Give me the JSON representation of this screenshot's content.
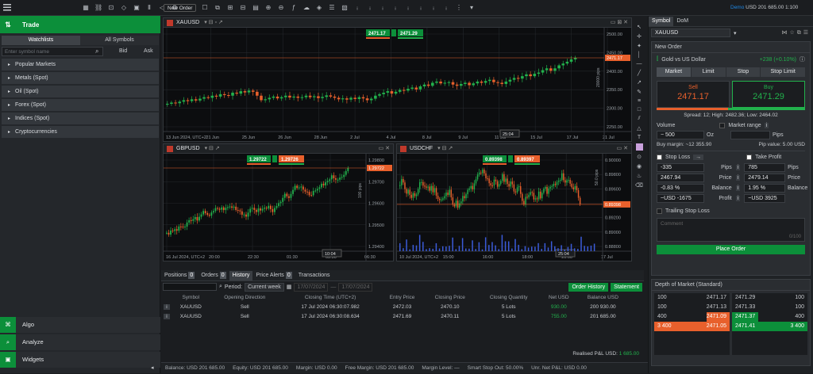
{
  "topbar": {
    "new_order": "New Order",
    "account": "Demo",
    "balance": "USD 201 685.00",
    "leverage": "1:100"
  },
  "left": {
    "trade": "Trade",
    "tabs": [
      "Watchlists",
      "All Symbols"
    ],
    "search_placeholder": "Enter symbol name",
    "bid": "Bid",
    "ask": "Ask",
    "categories": [
      "Popular Markets",
      "Metals (Spot)",
      "Oil (Spot)",
      "Forex (Spot)",
      "Indices (Spot)",
      "Cryptocurrencies"
    ],
    "nav": [
      "Algo",
      "Analyze",
      "Widgets"
    ]
  },
  "charts": {
    "main": {
      "symbol": "XAUUSD",
      "sell_tag": "2471.17",
      "buy_tag": "2471.29",
      "price_label": "2471.17",
      "y_ticks": [
        "2500.00",
        "2450.00",
        "2400.00",
        "2350.00",
        "2300.00",
        "2250.00"
      ],
      "pips_label": "20000 pips",
      "x_ticks": [
        "13 Jun 2024, UTC+2",
        "21 Jun",
        "25 Jun",
        "26 Jun",
        "28 Jun",
        "2 Jul",
        "4 Jul",
        "8 Jul",
        "9 Jul",
        "11 Jul",
        "15 Jul",
        "17 Jul",
        "21 Jul"
      ],
      "countdown": "25:04",
      "candles": [
        2318,
        2322,
        2320,
        2325,
        2330,
        2327,
        2333,
        2329,
        2335,
        2340,
        2338,
        2345,
        2342,
        2350,
        2347,
        2345,
        2355,
        2352,
        2360,
        2356,
        2362,
        2358,
        2345,
        2330,
        2333,
        2338,
        2342,
        2336,
        2340,
        2345,
        2339,
        2342,
        2338,
        2340,
        2345,
        2340,
        2343,
        2337,
        2341,
        2346,
        2342,
        2338,
        2333,
        2336,
        2332,
        2338,
        2334,
        2340,
        2336,
        2330,
        2335,
        2345,
        2350,
        2355,
        2360,
        2352,
        2358,
        2364,
        2362,
        2368,
        2372,
        2366,
        2376,
        2382,
        2378,
        2388,
        2392,
        2386,
        2388,
        2390,
        2382,
        2378,
        2384,
        2388,
        2380,
        2386,
        2392,
        2388,
        2394,
        2398,
        2390,
        2388,
        2384,
        2392,
        2398,
        2404,
        2402,
        2410,
        2416,
        2410,
        2418,
        2422,
        2430,
        2436,
        2428,
        2436,
        2446,
        2452,
        2458,
        2466,
        2471
      ]
    },
    "gbpusd": {
      "symbol": "GBPUSD",
      "sell_tag": "1.29722",
      "buy_tag": "1.29726",
      "price_label": "1.29722",
      "y_ticks": [
        "1.29800",
        "1.29700",
        "1.29600",
        "1.29500",
        "1.29400"
      ],
      "pips_label": "100 pips",
      "x_ticks": [
        "16 Jul 2024, UTC+2",
        "20:00",
        "22:30",
        "01:30",
        "03:30",
        "06:30"
      ],
      "countdown": "10:04"
    },
    "usdchf": {
      "symbol": "USDCHF",
      "sell_tag": "0.89398",
      "buy_tag": "0.89397",
      "price_label": "0.89398",
      "y_ticks": [
        "0.90000",
        "0.89800",
        "0.89600",
        "0.89400",
        "0.89200",
        "0.89000",
        "0.88800"
      ],
      "pips_label": "50.0 pips",
      "x_ticks": [
        "10 Jul 2024, UTC+2",
        "15:00",
        "16:00",
        "18:00",
        "20:00",
        "17 Jul"
      ],
      "countdown": "25:04"
    }
  },
  "bottom": {
    "tabs": [
      {
        "label": "Positions",
        "count": "0"
      },
      {
        "label": "Orders",
        "count": "0"
      },
      {
        "label": "History",
        "count": ""
      },
      {
        "label": "Price Alerts",
        "count": "0"
      },
      {
        "label": "Transactions",
        "count": ""
      }
    ],
    "period_label": "Period:",
    "period_value": "Current week",
    "date_from": "17/07/2024",
    "date_to": "17/07/2024",
    "order_history": "Order History",
    "statement": "Statement",
    "columns": [
      "Symbol",
      "Opening Direction",
      "Closing Time (UTC+2)",
      "Entry Price",
      "Closing Price",
      "Closing Quantity",
      "Net USD",
      "Balance USD"
    ],
    "rows": [
      [
        "XAUUSD",
        "Sell",
        "17 Jul 2024 06:30:07.982",
        "2472.03",
        "2470.10",
        "5 Lots",
        "930.00",
        "200 930.00"
      ],
      [
        "XAUUSD",
        "Sell",
        "17 Jul 2024 06:30:08.634",
        "2471.69",
        "2470.11",
        "5 Lots",
        "755.00",
        "201 685.00"
      ]
    ],
    "realised_label": "Realised P&L USD:",
    "realised_value": "1 685.00"
  },
  "status": {
    "balance": "Balance: USD 201 685.00",
    "equity": "Equity: USD 201 685.00",
    "margin": "Margin: USD 0.00",
    "free_margin": "Free Margin: USD 201 685.00",
    "margin_level": "Margin Level: —",
    "stop_out": "Smart Stop Out: 50.00%",
    "unr": "Unr. Net P&L: USD 0.00"
  },
  "right": {
    "tabs": [
      "Symbol",
      "DoM"
    ],
    "symbol": "XAUUSD",
    "new_order_title": "New Order",
    "instrument": "Gold vs US Dollar",
    "change": "+238 (+0.10%)",
    "order_types": [
      "Market",
      "Limit",
      "Stop",
      "Stop Limit"
    ],
    "sell_label": "Sell",
    "sell_price": "2471.17",
    "buy_label": "Buy",
    "buy_price": "2471.29",
    "spread_info": "Spread: 12; High: 2482.36; Low: 2464.02",
    "volume_label": "Volume",
    "market_range": "Market range",
    "volume_value": "500",
    "volume_unit": "Oz",
    "pips_unit": "Pips",
    "buy_margin": "Buy margin: ~12 355.90",
    "pip_value": "Pip value: 5.00 USD",
    "stop_loss": "Stop Loss",
    "take_profit": "Take Profit",
    "sl": {
      "pips": "-335",
      "price": "2467.94",
      "balance": "-0.83",
      "profit": "-1675"
    },
    "tp": {
      "pips": "785",
      "price": "2479.14",
      "balance": "1.95",
      "profit": "3925"
    },
    "labels": {
      "pips": "Pips",
      "price": "Price",
      "balance": "Balance",
      "profit": "Profit",
      "usd": "~USD",
      "pct": "%"
    },
    "trailing": "Trailing Stop Loss",
    "comment_placeholder": "Comment",
    "comment_count": "0/100",
    "place_order": "Place Order",
    "dom_title": "Depth of Market (Standard)",
    "dom_bids": [
      [
        "100",
        "2471.17"
      ],
      [
        "100",
        "2471.13"
      ],
      [
        "400",
        "2471.09"
      ],
      [
        "3 400",
        "2471.05"
      ]
    ],
    "dom_asks": [
      [
        "2471.29",
        "100"
      ],
      [
        "2471.33",
        "100"
      ],
      [
        "2471.37",
        "400"
      ],
      [
        "2471.41",
        "3 400"
      ]
    ]
  }
}
